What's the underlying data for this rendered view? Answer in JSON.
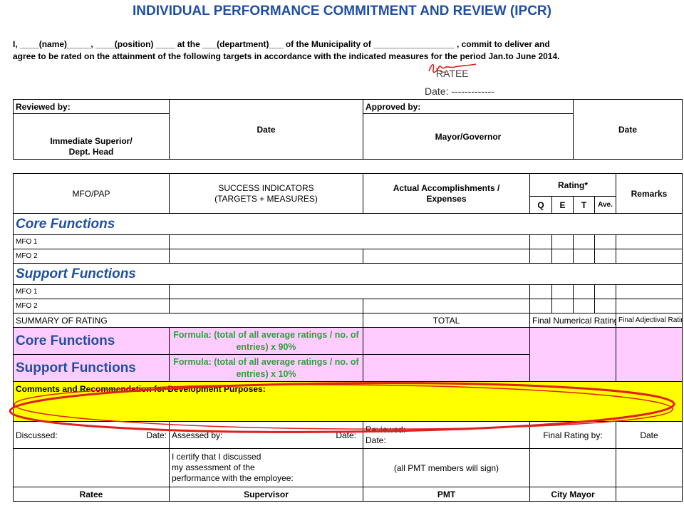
{
  "title": "INDIVIDUAL PERFORMANCE COMMITMENT AND REVIEW (IPCR)",
  "intro": {
    "line1": "I, ____(name)_____, ____(position) ____ at the ___(department)___ of the Municipality of _________________ , commit to deliver and",
    "line2": "agree to be rated on the attainment of the following targets in accordance with the indicated measures for the period Jan.to June 2014."
  },
  "ratee_label": "RATEE",
  "ratee_date": "Date: -------------",
  "review_table": {
    "reviewed_by": "Reviewed by:",
    "date1": "Date",
    "approved_by": "Approved by:",
    "date2": "Date",
    "immediate_superior_1": "Immediate Superior/",
    "immediate_superior_2": "Dept. Head",
    "mayor": "Mayor/Governor"
  },
  "main_table": {
    "headers": {
      "mfo": "MFO/PAP",
      "success_1": "SUCCESS INDICATORS",
      "success_2": "(TARGETS + MEASURES)",
      "actual_1": "Actual Accomplishments /",
      "actual_2": "Expenses",
      "rating": "Rating*",
      "remarks": "Remarks",
      "q": "Q",
      "e": "E",
      "t": "T",
      "ave": "Ave."
    },
    "core_functions": "Core Functions",
    "core_rows": [
      "MFO 1",
      "MFO 2"
    ],
    "support_functions": "Support Functions",
    "support_rows": [
      "MFO 1",
      "MFO 2"
    ],
    "summary": {
      "label": "SUMMARY OF RATING",
      "total": "TOTAL",
      "final_numerical": "Final Numerical Rating",
      "final_adjectival": "Final Adjectival Rating",
      "core_label": "Core Functions",
      "core_formula": "Formula: (total of all average ratings / no. of entries) x 90%",
      "support_label": "Support Functions",
      "support_formula": "Formula: (total of all average ratings / no. of entries) x 10%"
    },
    "comments": "Comments and Recommendation for Development Purposes:",
    "signoff": {
      "discussed": "Discussed:",
      "date_a": "Date:",
      "assessed_by": "Assessed by:",
      "date_b": "Date:",
      "reviewed": "Reviewed:",
      "date_c": "Date:",
      "final_rating_by": "Final Rating by:",
      "date_d": "Date",
      "certify_1": "I certify that I discussed",
      "certify_2": "my assessment of the",
      "certify_3": "performance with the employee:",
      "pmt_sign": "(all PMT members will sign)",
      "ratee": "Ratee",
      "supervisor": "Supervisor",
      "pmt": "PMT",
      "city_mayor": "City Mayor"
    }
  },
  "colors": {
    "title_blue": "#1f4fa3",
    "formula_green": "#2e9e3e",
    "summary_pink": "#ffccff",
    "comment_yellow": "#ffff00",
    "annotation_red": "#e0201b"
  }
}
